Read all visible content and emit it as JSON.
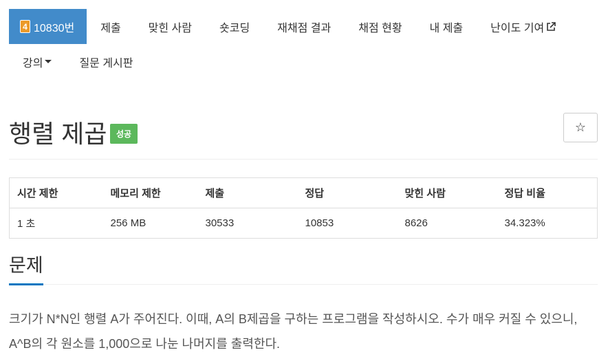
{
  "nav": {
    "problem_level": "4",
    "problem_number": "10830번",
    "items_row1": [
      "제출",
      "맞힌 사람",
      "숏코딩",
      "재채점 결과",
      "채점 현황",
      "내 제출",
      "난이도 기여"
    ],
    "items_row2": [
      "강의",
      "질문 게시판"
    ]
  },
  "problem": {
    "title": "행렬 제곱",
    "result_badge": "성공",
    "star_icon": "star-icon"
  },
  "info_table": {
    "headers": [
      "시간 제한",
      "메모리 제한",
      "제출",
      "정답",
      "맞힌 사람",
      "정답 비율"
    ],
    "values": [
      "1 초",
      "256 MB",
      "30533",
      "10853",
      "8626",
      "34.323%"
    ]
  },
  "section": {
    "title": "문제",
    "description": "크기가 N*N인 행렬 A가 주어진다. 이때, A의 B제곱을 구하는 프로그램을 작성하시오. 수가 매우 커질 수 있으니, A^B의 각 원소를 1,000으로 나눈 나머지를 출력한다."
  },
  "colors": {
    "active_tab": "#428bca",
    "level_badge": "#ec9a29",
    "success_badge": "#5cb85c",
    "section_underline": "#0076c0"
  }
}
